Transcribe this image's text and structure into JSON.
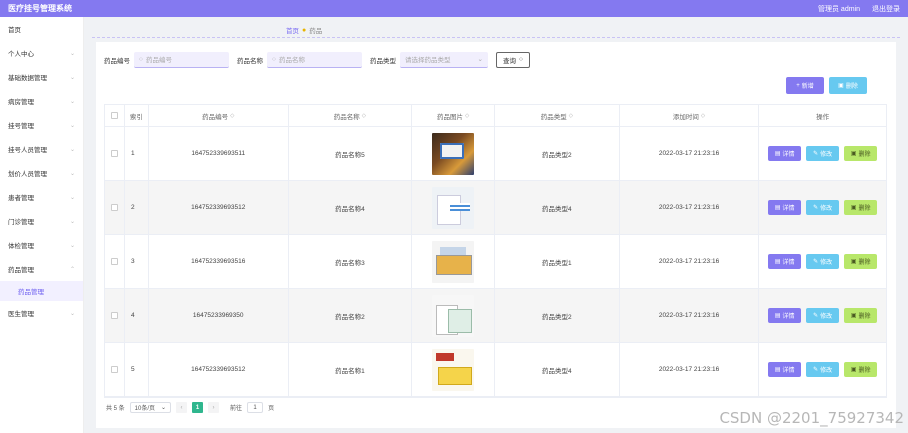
{
  "app": {
    "title": "医疗挂号管理系统",
    "user": "管理员 admin",
    "logout": "退出登录"
  },
  "sidebar": {
    "items": [
      {
        "label": "首页",
        "chev": ""
      },
      {
        "label": "个人中心",
        "chev": "⌄"
      },
      {
        "label": "基础数据管理",
        "chev": "⌄"
      },
      {
        "label": "病房管理",
        "chev": "⌄"
      },
      {
        "label": "挂号管理",
        "chev": "⌄"
      },
      {
        "label": "挂号人员管理",
        "chev": "⌄"
      },
      {
        "label": "划价人员管理",
        "chev": "⌄"
      },
      {
        "label": "患者管理",
        "chev": "⌄"
      },
      {
        "label": "门诊管理",
        "chev": "⌄"
      },
      {
        "label": "体检管理",
        "chev": "⌄"
      },
      {
        "label": "药品管理",
        "chev": "⌃"
      }
    ],
    "sub_item": "药品管理",
    "last_item": {
      "label": "医生管理",
      "chev": "⌄"
    }
  },
  "breadcrumb": {
    "home": "首页",
    "current": "药品"
  },
  "search": {
    "num_label": "药品编号",
    "num_placeholder": "药品编号",
    "name_label": "药品名称",
    "name_placeholder": "药品名称",
    "type_label": "药品类型",
    "type_placeholder": "请选择药品类型",
    "query_label": "查询"
  },
  "actions": {
    "add": "新增",
    "delete": "删除"
  },
  "table": {
    "headers": {
      "index": "索引",
      "number": "药品编号",
      "name": "药品名称",
      "image": "药品图片",
      "type": "药品类型",
      "time": "添加时间",
      "ops": "操作"
    },
    "rows": [
      {
        "index": "1",
        "number": "164752339693511",
        "name": "药品名称5",
        "type": "药品类型2",
        "time": "2022-03-17 21:23:16"
      },
      {
        "index": "2",
        "number": "164752339693512",
        "name": "药品名称4",
        "type": "药品类型4",
        "time": "2022-03-17 21:23:16"
      },
      {
        "index": "3",
        "number": "164752339693516",
        "name": "药品名称3",
        "type": "药品类型1",
        "time": "2022-03-17 21:23:16"
      },
      {
        "index": "4",
        "number": "16475233969350",
        "name": "药品名称2",
        "type": "药品类型2",
        "time": "2022-03-17 21:23:16"
      },
      {
        "index": "5",
        "number": "164752339693512",
        "name": "药品名称1",
        "type": "药品类型4",
        "time": "2022-03-17 21:23:16"
      }
    ],
    "op_labels": {
      "detail": "详情",
      "edit": "修改",
      "remove": "删除"
    }
  },
  "pagination": {
    "total": "共 5 条",
    "page_size": "10条/页",
    "current": "1",
    "goto_label": "前往",
    "goto_value": "1",
    "page_unit": "页"
  },
  "watermark": "CSDN @2201_75927342"
}
